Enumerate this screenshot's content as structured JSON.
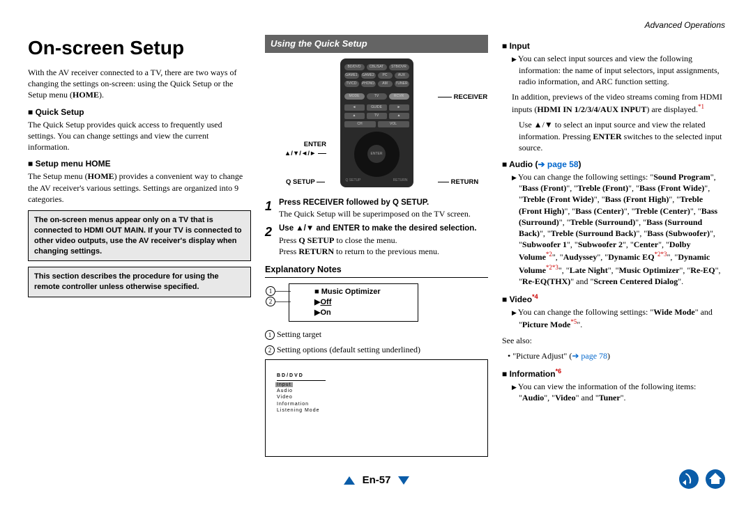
{
  "header": {
    "section": "Advanced Operations"
  },
  "col1": {
    "title": "On-screen Setup",
    "intro": "With the AV receiver connected to a TV, there are two ways of changing the settings on-screen: using the Quick Setup or the Setup menu (HOME).",
    "qs_head": "Quick Setup",
    "qs_body": "The Quick Setup provides quick access to frequently used settings. You can change settings and view the current information.",
    "sm_head": "Setup menu HOME",
    "sm_body": "The Setup menu (HOME) provides a convenient way to change the AV receiver's various settings. Settings are organized into 9 categories.",
    "box1": "The on-screen menus appear only on a TV that is connected to HDMI OUT MAIN. If your TV is connected to other video outputs, use the AV receiver's display when changing settings.",
    "box2": "This section describes the procedure for using the remote controller unless otherwise specified."
  },
  "col2": {
    "bar": "Using the Quick Setup",
    "lbl_receiver": "RECEIVER",
    "lbl_enter": "ENTER",
    "lbl_arrows": "▲/▼/◄/►",
    "lbl_qsetup": "Q SETUP",
    "lbl_return": "RETURN",
    "step1_lead": "Press RECEIVER followed by Q SETUP.",
    "step1_body": "The Quick Setup will be superimposed on the TV screen.",
    "step2_lead": "Use ▲/▼ and ENTER to make the desired selection.",
    "step2_b1": "Press Q SETUP to close the menu.",
    "step2_b2": "Press RETURN to return to the previous menu.",
    "expl_head": "Explanatory Notes",
    "expl_item": "Music Optimizer",
    "expl_off": "Off",
    "expl_on": "On",
    "expl_1": "Setting target",
    "expl_2": "Setting options (default setting underlined)",
    "screen": {
      "top": "BD/DVD",
      "hl": "Input",
      "l1": "Audio",
      "l2": "Video",
      "l3": "Information",
      "l4": "Listening Mode"
    }
  },
  "col3": {
    "input_head": "Input",
    "input_b1": "You can select input sources and view the following information: the name of input selectors, input assignments, radio information, and ARC function setting.",
    "input_b2a": "In addition, previews of the video streams coming from HDMI inputs (",
    "input_b2b": "HDMI IN 1/2/3/4/AUX INPUT",
    "input_b2c": ") are displayed.",
    "input_sup1": "*1",
    "input_b3a": "Use ▲/▼ to select an input source and view the related information. Pressing ",
    "input_b3b": "ENTER",
    "input_b3c": " switches to the selected input source.",
    "audio_head": "Audio (",
    "audio_link": "➔ page 58",
    "audio_head2": ")",
    "audio_body": "You can change the following settings: \"Sound Program\", \"Bass (Front)\", \"Treble (Front)\", \"Bass (Front Wide)\", \"Treble (Front Wide)\", \"Bass (Front High)\", \"Treble (Front High)\", \"Bass (Center)\", \"Treble (Center)\", \"Bass (Surround)\", \"Treble (Surround)\", \"Bass (Surround Back)\", \"Treble (Surround Back)\", \"Bass (Subwoofer)\", \"Subwoofer 1\", \"Subwoofer 2\", \"Center\", \"Dolby Volume*2\", \"Audyssey\", \"Dynamic EQ*2*3\", \"Dynamic Volume*2*3\", \"Late Night\", \"Music Optimizer\", \"Re-EQ\", \"Re-EQ(THX)\" and \"Screen Centered Dialog\".",
    "video_head": "Video",
    "video_sup": "*4",
    "video_body": "You can change the following settings: \"Wide Mode\" and \"Picture Mode*5\".",
    "see_also": "See also:",
    "pic_adj": "\"Picture Adjust\" (",
    "pic_link": "➔ page 78",
    "pic_adj2": ")",
    "info_head": "Information",
    "info_sup": "*6",
    "info_body": "You can view the information of the following items: \"Audio\", \"Video\" and \"Tuner\"."
  },
  "nav": {
    "page": "En-57"
  }
}
